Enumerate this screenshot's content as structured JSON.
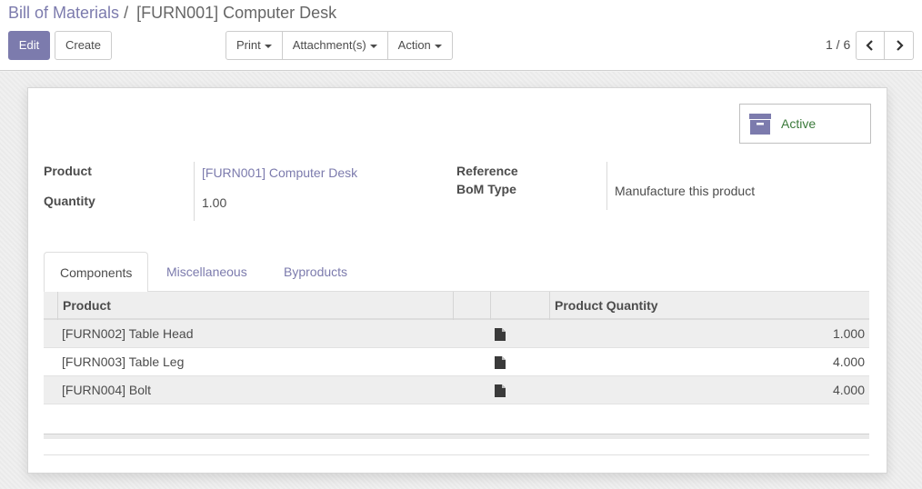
{
  "breadcrumb": {
    "parent": "Bill of Materials",
    "separator": "/",
    "current": "[FURN001] Computer Desk"
  },
  "toolbar": {
    "edit_label": "Edit",
    "create_label": "Create",
    "print_label": "Print",
    "attachments_label": "Attachment(s)",
    "action_label": "Action"
  },
  "pager": {
    "value": "1 / 6"
  },
  "status": {
    "label": "Active",
    "icon": "archive-icon"
  },
  "form": {
    "product_label": "Product",
    "product_value": "[FURN001] Computer Desk",
    "quantity_label": "Quantity",
    "quantity_value": "1.00",
    "reference_label": "Reference",
    "reference_value": "",
    "bom_type_label": "BoM Type",
    "bom_type_value": "Manufacture this product"
  },
  "tabs": [
    {
      "label": "Components",
      "active": true
    },
    {
      "label": "Miscellaneous",
      "active": false
    },
    {
      "label": "Byproducts",
      "active": false
    }
  ],
  "components": {
    "columns": [
      "Product",
      "",
      "",
      "Product Quantity"
    ],
    "rows": [
      {
        "product": "[FURN002] Table Head",
        "quantity": "1.000"
      },
      {
        "product": "[FURN003] Table Leg",
        "quantity": "4.000"
      },
      {
        "product": "[FURN004] Bolt",
        "quantity": "4.000"
      }
    ]
  },
  "colors": {
    "accent": "#7c7bad",
    "active_text": "#3b7a3b"
  }
}
